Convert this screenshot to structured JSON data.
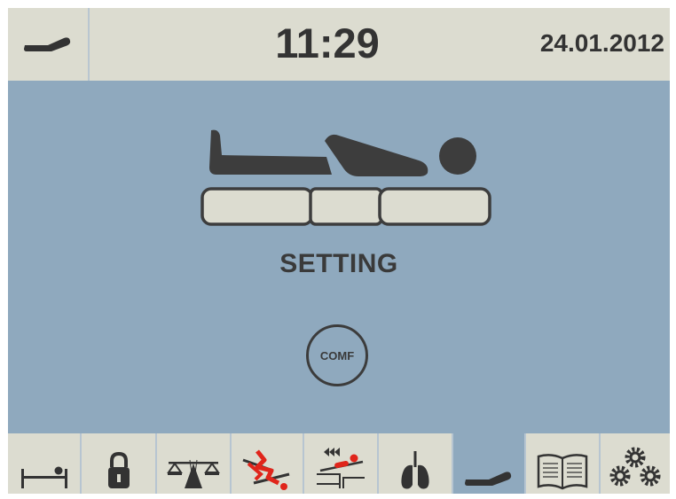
{
  "header": {
    "mode_icon": "bed-position-icon",
    "time": "11:29",
    "date": "24.01.2012"
  },
  "main": {
    "illustration": "patient-lying-on-mattress-icon",
    "title": "SETTING",
    "comf_button_label": "COMF"
  },
  "toolbar": {
    "active_tab": "bed-position",
    "tabs": [
      {
        "name": "bed-exit",
        "icon": "bed-exit-icon"
      },
      {
        "name": "lock",
        "icon": "padlock-icon"
      },
      {
        "name": "weighing-scale",
        "icon": "scale-icon"
      },
      {
        "name": "cpr",
        "icon": "cpr-icon"
      },
      {
        "name": "trendelenburg",
        "icon": "trendelenburg-icon"
      },
      {
        "name": "lungs-therapy",
        "icon": "lungs-icon"
      },
      {
        "name": "bed-position",
        "icon": "bed-position-icon"
      },
      {
        "name": "manual",
        "icon": "book-icon"
      },
      {
        "name": "settings",
        "icon": "gears-icon"
      }
    ]
  },
  "colors": {
    "background": "#8fa9be",
    "panel": "#dcdcd0",
    "foreground": "#3a3a3a",
    "alert_red": "#e0251b"
  }
}
